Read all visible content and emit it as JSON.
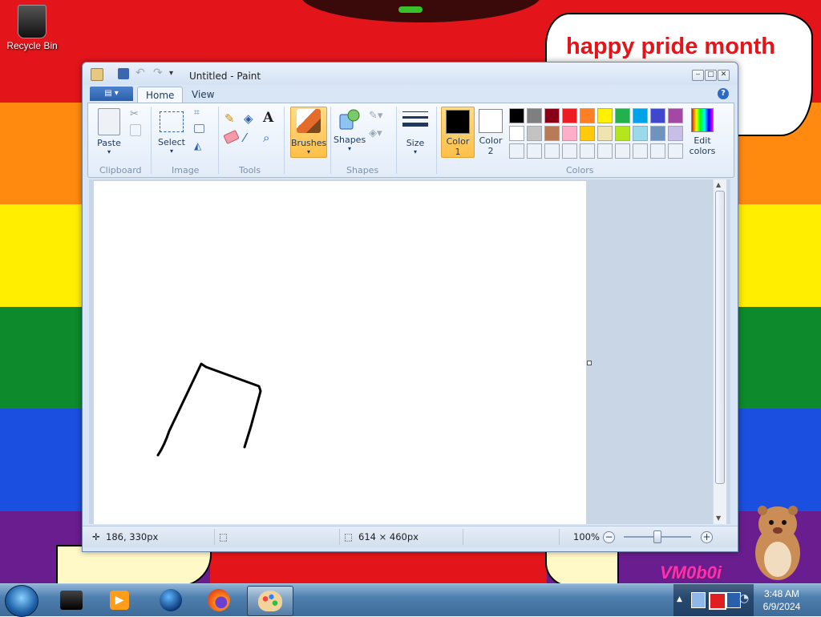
{
  "desktop": {
    "recycle_bin_label": "Recycle Bin",
    "bubble_text": "happy pride month",
    "watermark_text": "VM0b0i"
  },
  "window": {
    "title": "Untitled - Paint",
    "tabs": [
      {
        "label": "Home",
        "active": true
      },
      {
        "label": "View",
        "active": false
      }
    ],
    "ribbon": {
      "groups": {
        "clipboard": "Clipboard",
        "image": "Image",
        "tools": "Tools",
        "shapes": "Shapes",
        "colors": "Colors"
      },
      "paste_label": "Paste",
      "select_label": "Select",
      "brushes_label": "Brushes",
      "shapes_label": "Shapes",
      "size_label": "Size",
      "color1_label": "Color\n1",
      "color2_label": "Color\n2",
      "edit_colors_label": "Edit\ncolors",
      "color1_value": "#000000",
      "color2_value": "#ffffff",
      "palette_row1": [
        "#000000",
        "#7f7f7f",
        "#880015",
        "#ed1c24",
        "#ff7f27",
        "#fff200",
        "#22b14c",
        "#00a2e8",
        "#3f48cc",
        "#a349a4"
      ],
      "palette_row2": [
        "#ffffff",
        "#c3c3c3",
        "#b97a57",
        "#ffaec9",
        "#ffc90e",
        "#efe4b0",
        "#b5e61d",
        "#99d9ea",
        "#7092be",
        "#c8bfe7"
      ]
    },
    "status": {
      "cursor_pos": "186, 330px",
      "canvas_size": "614 × 460px",
      "zoom": "100%"
    }
  },
  "taskbar": {
    "time": "3:48 AM",
    "date": "6/9/2024"
  }
}
